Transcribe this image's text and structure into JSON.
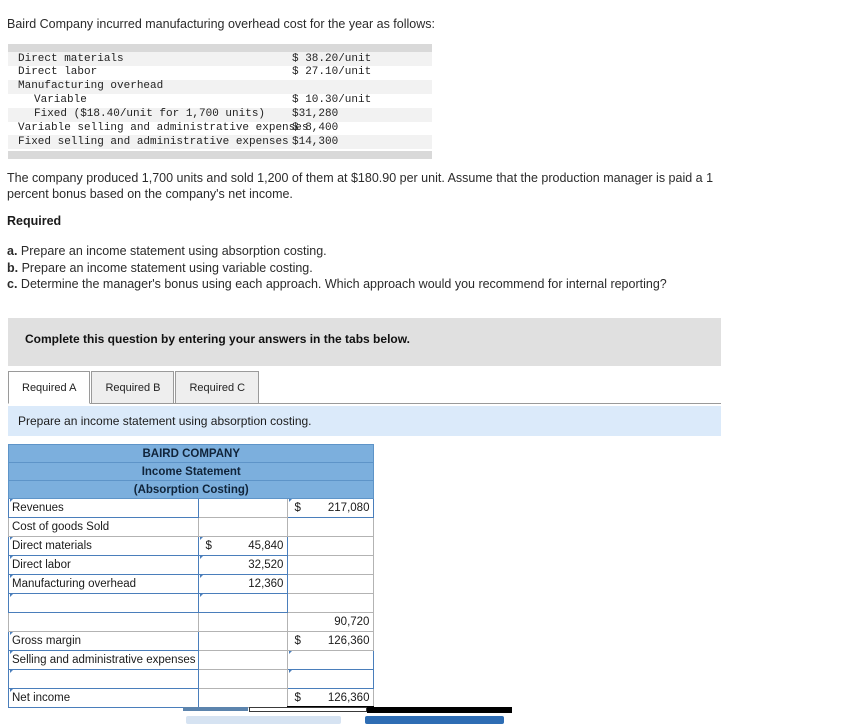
{
  "intro": {
    "text": "Baird Company incurred manufacturing overhead cost for the year as follows:"
  },
  "given_table": {
    "rows": [
      {
        "label": "Direct materials",
        "value": "$ 38.20/unit",
        "indent": 0
      },
      {
        "label": "Direct labor",
        "value": "$ 27.10/unit",
        "indent": 0
      },
      {
        "label": "Manufacturing overhead",
        "value": "",
        "indent": 0
      },
      {
        "label": "Variable",
        "value": "$ 10.30/unit",
        "indent": 1
      },
      {
        "label": "Fixed ($18.40/unit for 1,700 units)",
        "value": "$31,280",
        "indent": 1
      },
      {
        "label": "Variable selling and administrative expenses",
        "value": "$ 8,400",
        "indent": 0
      },
      {
        "label": "Fixed selling and administrative expenses",
        "value": "$14,300",
        "indent": 0
      }
    ]
  },
  "paragraph": {
    "line1": "The company produced 1,700 units and sold 1,200 of them at $180.90 per unit. Assume that the production manager is paid a 1",
    "line2": "percent bonus based on the company's net income."
  },
  "required": {
    "heading": "Required",
    "items": [
      {
        "letter": "a.",
        "text": "Prepare an income statement using absorption costing."
      },
      {
        "letter": "b.",
        "text": "Prepare an income statement using variable costing."
      },
      {
        "letter": "c.",
        "text": "Determine the manager's bonus using each approach. Which approach would you recommend for internal reporting?"
      }
    ]
  },
  "banner": {
    "text": "Complete this question by entering your answers in the tabs below."
  },
  "tabs": {
    "items": [
      {
        "label": "Required A",
        "active": true
      },
      {
        "label": "Required B",
        "active": false
      },
      {
        "label": "Required C",
        "active": false
      }
    ]
  },
  "subbanner": {
    "text": "Prepare an income statement using absorption costing."
  },
  "statement": {
    "title_lines": [
      "BAIRD COMPANY",
      "Income Statement",
      "(Absorption Costing)"
    ],
    "rows": [
      {
        "label": "Revenues",
        "mid_sym": "",
        "mid": "",
        "right_sym": "$",
        "right": "217,080",
        "label_edit": true,
        "mid_edit": false,
        "right_edit": true,
        "style": ""
      },
      {
        "label": "Cost of goods Sold",
        "mid_sym": "",
        "mid": "",
        "right_sym": "",
        "right": "",
        "label_edit": false,
        "mid_edit": false,
        "right_edit": false,
        "style": ""
      },
      {
        "label": "Direct materials",
        "mid_sym": "$",
        "mid": "45,840",
        "right_sym": "",
        "right": "",
        "label_edit": true,
        "mid_edit": true,
        "right_edit": false,
        "style": ""
      },
      {
        "label": "Direct labor",
        "mid_sym": "",
        "mid": "32,520",
        "right_sym": "",
        "right": "",
        "label_edit": true,
        "mid_edit": true,
        "right_edit": false,
        "style": ""
      },
      {
        "label": "Manufacturing overhead",
        "mid_sym": "",
        "mid": "12,360",
        "right_sym": "",
        "right": "",
        "label_edit": true,
        "mid_edit": true,
        "right_edit": false,
        "style": ""
      },
      {
        "label": "",
        "mid_sym": "",
        "mid": "",
        "right_sym": "",
        "right": "",
        "label_edit": true,
        "mid_edit": true,
        "right_edit": false,
        "style": ""
      },
      {
        "label": "",
        "mid_sym": "",
        "mid": "",
        "right_sym": "",
        "right": "90,720",
        "label_edit": false,
        "mid_edit": false,
        "right_edit": false,
        "style": "subtotal"
      },
      {
        "label": "Gross margin",
        "mid_sym": "",
        "mid": "",
        "right_sym": "$",
        "right": "126,360",
        "label_edit": true,
        "mid_edit": false,
        "right_edit": false,
        "style": ""
      },
      {
        "label": "Selling and administrative expenses",
        "mid_sym": "",
        "mid": "",
        "right_sym": "",
        "right": "",
        "label_edit": true,
        "mid_edit": false,
        "right_edit": true,
        "style": ""
      },
      {
        "label": "",
        "mid_sym": "",
        "mid": "",
        "right_sym": "",
        "right": "",
        "label_edit": true,
        "mid_edit": false,
        "right_edit": true,
        "style": ""
      },
      {
        "label": "Net income",
        "mid_sym": "",
        "mid": "",
        "right_sym": "$",
        "right": "126,360",
        "label_edit": true,
        "mid_edit": false,
        "right_edit": false,
        "style": "grand"
      }
    ]
  },
  "footer_buttons": {
    "prev_label": "",
    "next_label": "",
    "prev_color": "#d6e3f2",
    "next_color": "#2e6db4"
  }
}
